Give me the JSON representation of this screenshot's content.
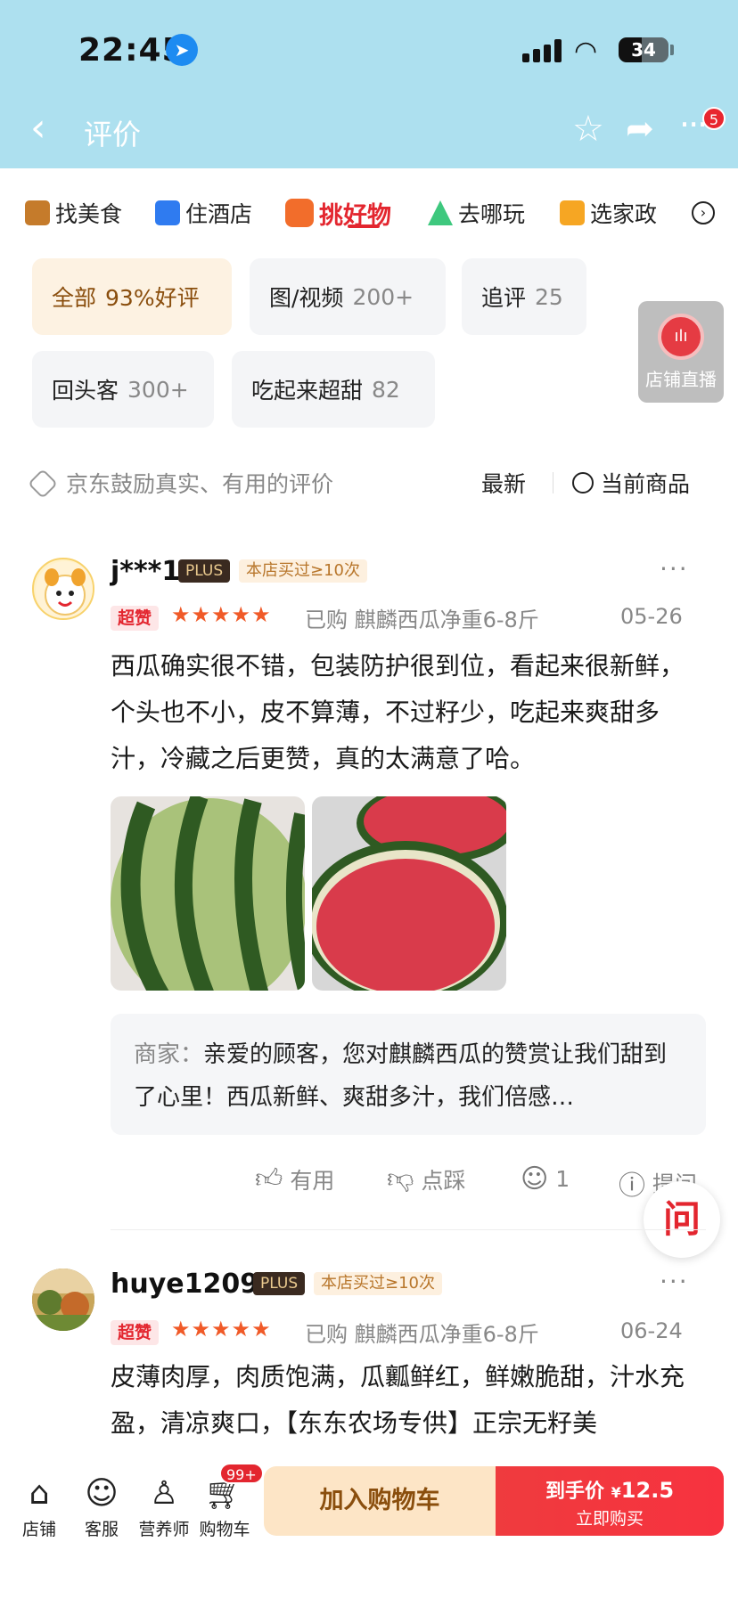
{
  "status_bar": {
    "time": "22:45",
    "battery": "34"
  },
  "nav": {
    "title": "评价",
    "badge": "5"
  },
  "channels": [
    {
      "label": "找美食",
      "color": "#c57b2b"
    },
    {
      "label": "住酒店",
      "color": "#2f7bf0"
    },
    {
      "label": "挑好物",
      "color": "#f26d2b"
    },
    {
      "label": "去哪玩",
      "color": "#3ec87e"
    },
    {
      "label": "选家政",
      "color": "#f6a623"
    }
  ],
  "filters": [
    {
      "label": "全部",
      "count": "93%好评"
    },
    {
      "label": "图/视频",
      "count": "200+"
    },
    {
      "label": "追评",
      "count": "25"
    },
    {
      "label": "回头客",
      "count": "300+"
    },
    {
      "label": "吃起来超甜",
      "count": "82"
    }
  ],
  "live": {
    "label": "店铺直播"
  },
  "hint": "京东鼓励真实、有用的评价",
  "sort": {
    "latest": "最新",
    "current": "当前商品"
  },
  "reviews": [
    {
      "user": "j***1",
      "plus": "PLUS",
      "tag": "本店买过≥10次",
      "super": "超赞",
      "stars": "★★★★★",
      "bought": "已购 麒麟西瓜净重6-8斤",
      "date": "05-26",
      "text": "西瓜确实很不错，包装防护很到位，看起来很新鲜，个头也不小，皮不算薄，不过籽少，吃起来爽甜多汁，冷藏之后更赞，真的太满意了哈。",
      "reply_label": "商家：",
      "reply_text": "亲爱的顾客，您对麒麟西瓜的赞赏让我们甜到了心里！西瓜新鲜、爽甜多汁，我们倍感…",
      "actions": {
        "useful": "有用",
        "dislike": "点踩",
        "comments": "1",
        "ask": "提问"
      }
    },
    {
      "user": "huye1209",
      "plus": "PLUS",
      "tag": "本店买过≥10次",
      "super": "超赞",
      "stars": "★★★★★",
      "bought": "已购 麒麟西瓜净重6-8斤",
      "date": "06-24",
      "text": "皮薄肉厚，肉质饱满，瓜瓤鲜红，鲜嫩脆甜，汁水充盈，清凉爽口，【东东农场专供】正宗无籽美"
    }
  ],
  "ask_fab": "问",
  "bottom": {
    "store": "店铺",
    "service": "客服",
    "nutritionist": "营养师",
    "cart": "购物车",
    "cart_badge": "99+",
    "add_cart": "加入购物车",
    "price_label": "到手价",
    "price_yen": "¥",
    "price": "12.5",
    "buy_now": "立即购买"
  }
}
